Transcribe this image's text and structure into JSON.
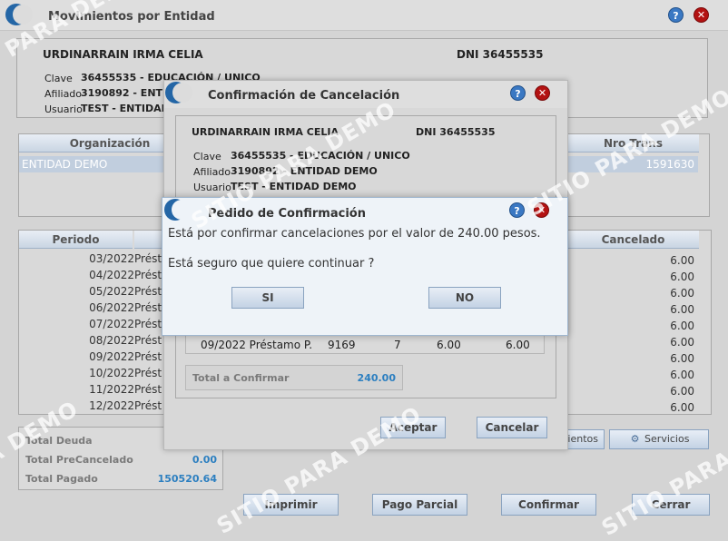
{
  "main": {
    "title": "Movimientos por Entidad",
    "person_name": "URDINARRAIN IRMA CELIA",
    "dni": "DNI  36455535",
    "clave_label": "Clave",
    "clave_value": "36455535  -  EDUCACIÓN / UNICO",
    "afiliado_label": "Afiliado",
    "afiliado_value": "3190892  -  ENT",
    "usuario_label": "Usuario",
    "usuario_value": "TEST  -  ENTIDAD",
    "org_table": {
      "col_org": "Organización",
      "col_nro": "Nro Trans",
      "row_org": "ENTIDAD DEMO",
      "row_nro": "1591630"
    },
    "periods_table": {
      "col_periodo": "Periodo",
      "col_cancelado": "Cancelado",
      "rows": [
        {
          "periodo": "03/2022",
          "concepto": "Prést",
          "cancelado": "6.00"
        },
        {
          "periodo": "04/2022",
          "concepto": "Prést",
          "cancelado": "6.00"
        },
        {
          "periodo": "05/2022",
          "concepto": "Prést",
          "cancelado": "6.00"
        },
        {
          "periodo": "06/2022",
          "concepto": "Prést",
          "cancelado": "6.00"
        },
        {
          "periodo": "07/2022",
          "concepto": "Prést",
          "cancelado": "6.00"
        },
        {
          "periodo": "08/2022",
          "concepto": "Prést",
          "cancelado": "6.00"
        },
        {
          "periodo": "09/2022",
          "concepto": "Prést",
          "cancelado": "6.00"
        },
        {
          "periodo": "10/2022",
          "concepto": "Prést",
          "cancelado": "6.00"
        },
        {
          "periodo": "11/2022",
          "concepto": "Prést",
          "cancelado": "6.00"
        },
        {
          "periodo": "12/2022",
          "concepto": "Prést",
          "cancelado": "6.00"
        }
      ]
    },
    "totals": {
      "deuda_label": "Total Deuda",
      "precancelado_label": "Total PreCancelado",
      "precancelado_value": "0.00",
      "pagado_label": "Total Pagado",
      "pagado_value": "150520.64"
    },
    "movimientos_btn": "ientos",
    "servicios_btn": "Servicios",
    "buttons": {
      "imprimir": "Imprimir",
      "pago_parcial": "Pago Parcial",
      "confirmar": "Confirmar",
      "cerrar": "Cerrar"
    }
  },
  "cancel_dialog": {
    "title": "Confirmación de Cancelación",
    "person_name": "URDINARRAIN IRMA CELIA",
    "dni": "DNI  36455535",
    "clave_label": "Clave",
    "clave_value": "36455535  -  EDUCACIÓN / UNICO",
    "afiliado_label": "Afiliado",
    "afiliado_value": "3190892  -  ENTIDAD DEMO",
    "usuario_label": "Usuario",
    "usuario_value": "TEST  -  ENTIDAD DEMO",
    "row": {
      "periodo": "09/2022 Préstamo P.",
      "nro": "9169",
      "cuota": "7",
      "importe": "6.00",
      "cancelado": "6.00"
    },
    "total_label": "Total a Confirmar",
    "total_value": "240.00",
    "aceptar": "Aceptar",
    "cancelar": "Cancelar"
  },
  "confirm_dialog": {
    "title": "Pedido de Confirmación",
    "message": "Está por confirmar cancelaciones por el valor de 240.00 pesos.",
    "question": "Está seguro que quiere continuar ?",
    "si": "SI",
    "no": "NO"
  },
  "watermark": "SITIO PARA DEMO",
  "colors": {
    "accent_blue": "#2c7fc0",
    "close_red": "#b31212",
    "dialog_title_bg": "#eef3f8"
  }
}
